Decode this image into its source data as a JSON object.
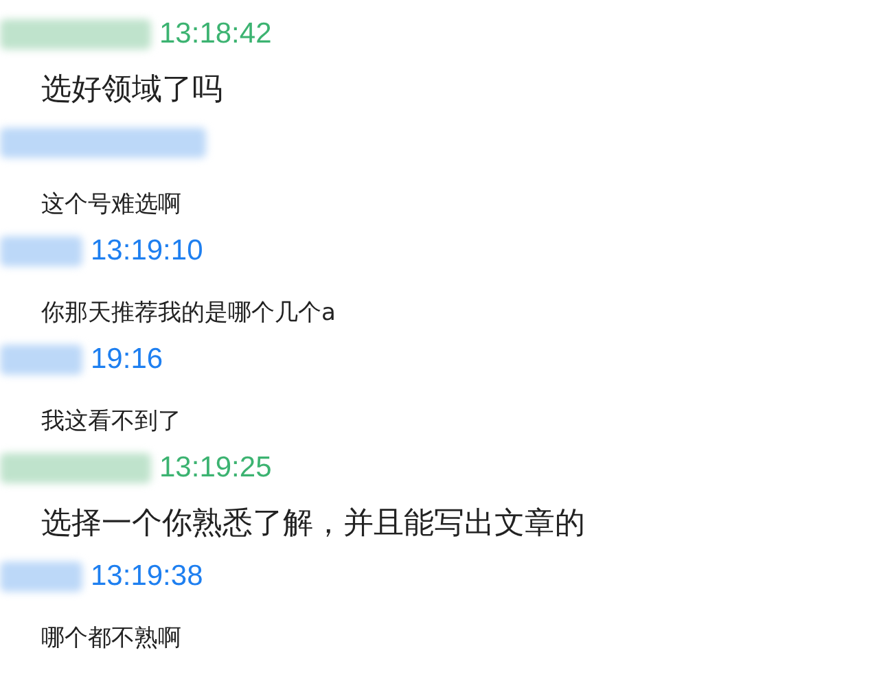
{
  "messages": [
    {
      "kind": "self",
      "time": "13:18:42",
      "text": "选好领域了吗"
    },
    {
      "kind": "other",
      "text": "这个号难选啊"
    },
    {
      "kind": "other",
      "time": "13:19:10",
      "text": "你那天推荐我的是哪个几个a"
    },
    {
      "kind": "other",
      "time": "19:16",
      "text": "我这看不到了"
    },
    {
      "kind": "self",
      "time": "13:19:25",
      "text": "选择一个你熟悉了解，并且能写出文章的"
    },
    {
      "kind": "other",
      "time": "13:19:38",
      "text": "哪个都不熟啊"
    }
  ]
}
